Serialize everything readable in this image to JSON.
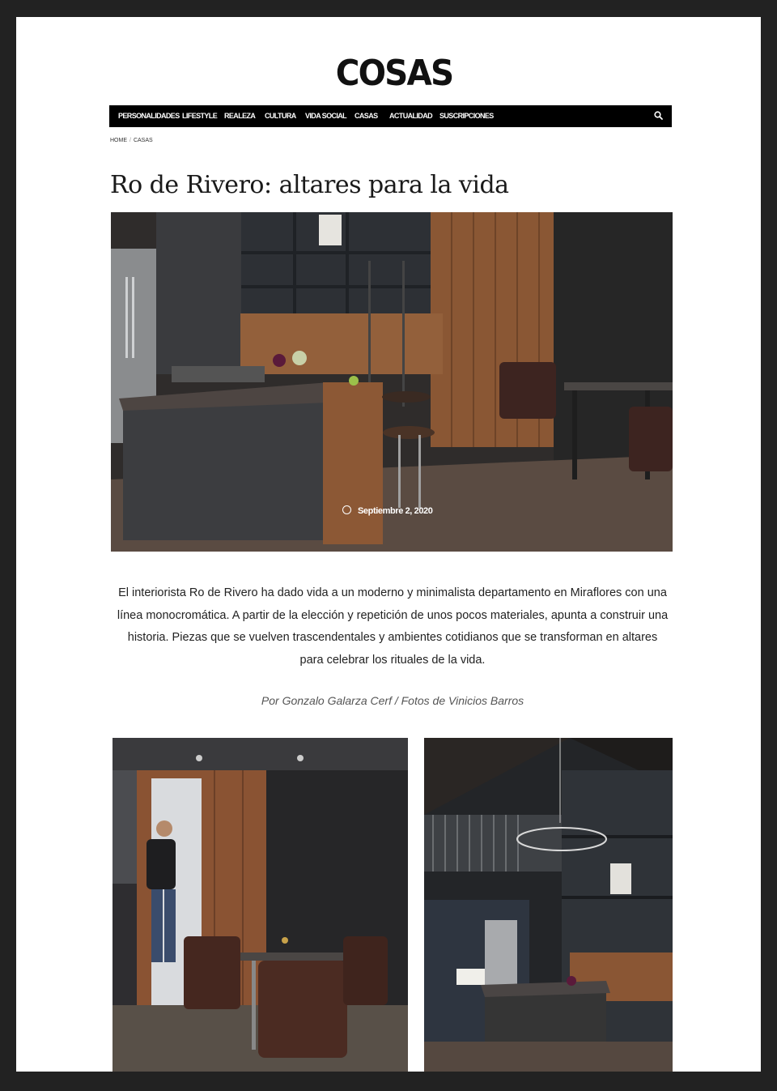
{
  "site": {
    "logo": "COSAS"
  },
  "nav": {
    "items": [
      {
        "label": "PERSONALIDADES"
      },
      {
        "label": "LIFESTYLE"
      },
      {
        "label": "REALEZA"
      },
      {
        "label": "CULTURA"
      },
      {
        "label": "VIDA SOCIAL"
      },
      {
        "label": "CASAS"
      },
      {
        "label": "ACTUALIDAD"
      },
      {
        "label": "SUSCRIPCIONES"
      }
    ],
    "search_icon": "search-icon"
  },
  "breadcrumb": {
    "home": "HOME",
    "separator": "/",
    "current": "CASAS"
  },
  "article": {
    "title": "Ro de Rivero: altares para la vida",
    "date": "Septiembre 2, 2020",
    "date_icon": "clock-icon",
    "intro": "El interiorista Ro de Rivero ha dado vida a un moderno y minimalista departamento en Miraflores con una línea monocromática. A partir de la elección y repetición de unos pocos materiales, apunta a construir una historia. Piezas que se vuelven trascendentales y ambientes cotidianos que se transforman en altares para celebrar los rituales de la vida.",
    "byline": "Por Gonzalo Galarza Cerf / Fotos de Vinicios Barros"
  },
  "colors": {
    "page_background": "#222222",
    "nav_background": "#000000",
    "nav_text": "#ffffff",
    "body_text": "#222222",
    "byline_text": "#555555"
  }
}
